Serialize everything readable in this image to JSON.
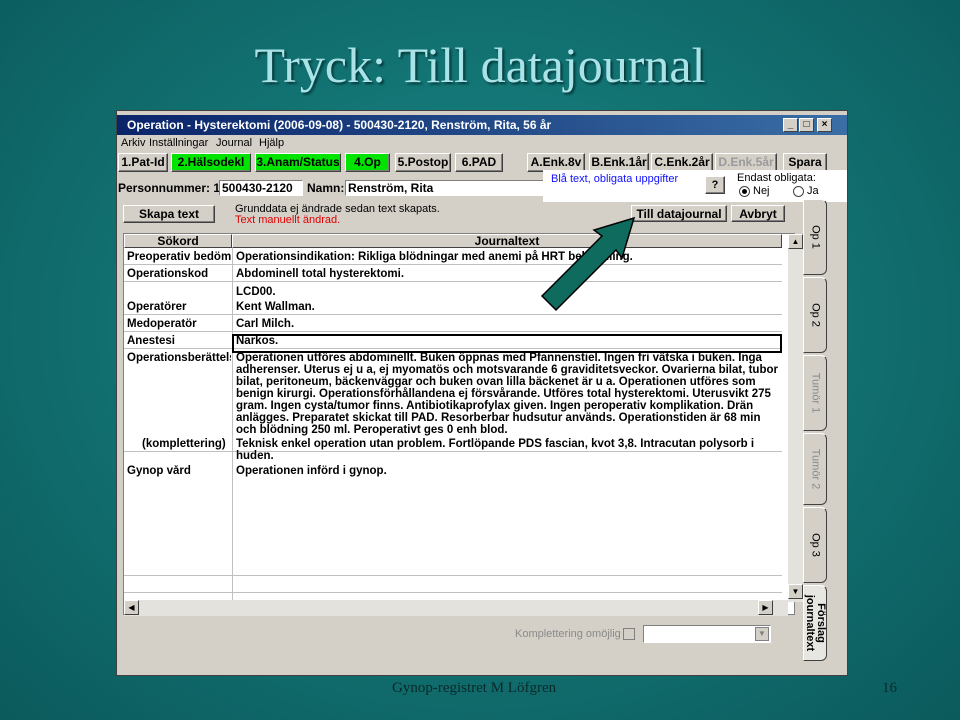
{
  "slide": {
    "title": "Tryck: Till datajournal",
    "footer": "Gynop-registret M Löfgren",
    "page_number": "16"
  },
  "window": {
    "title": "Operation - Hysterektomi (2006-09-08) - 500430-2120, Renström, Rita, 56 år",
    "controls": {
      "minimize": "_",
      "maximize": "□",
      "close": "×"
    }
  },
  "menu": [
    "Arkiv",
    "Inställningar",
    "Journal",
    "Hjälp"
  ],
  "toolbar": [
    {
      "label": "1.Pat-Id",
      "state": "normal"
    },
    {
      "label": "2.Hälsodekl",
      "state": "green"
    },
    {
      "label": "3.Anam/Status",
      "state": "green"
    },
    {
      "label": "4.Op",
      "state": "green"
    },
    {
      "label": "5.Postop",
      "state": "normal"
    },
    {
      "label": "6.PAD",
      "state": "normal"
    },
    {
      "label": "A.Enk.8v",
      "state": "normal"
    },
    {
      "label": "B.Enk.1år",
      "state": "normal"
    },
    {
      "label": "C.Enk.2år",
      "state": "normal"
    },
    {
      "label": "D.Enk.5år",
      "state": "disabled"
    },
    {
      "label": "Spara",
      "state": "normal"
    }
  ],
  "patient": {
    "pnr_label": "Personnummer: 19",
    "pnr_value": "500430-2120",
    "name_label": "Namn:",
    "name_value": "Renström, Rita"
  },
  "info": {
    "blue_note": "Blå text, obligata uppgifter",
    "help": "?",
    "only_required_label": "Endast obligata:",
    "radio_no": "Nej",
    "radio_yes": "Ja"
  },
  "actions": {
    "create_text": "Skapa text",
    "note_grey": "Grunddata ej ändrade sedan text skapats.",
    "note_red": "Text manuellt ändrad.",
    "to_journal": "Till datajournal",
    "cancel": "Avbryt"
  },
  "table": {
    "headers": [
      "Sökord",
      "Journaltext"
    ],
    "rows": [
      {
        "k": "Preoperativ bedömning",
        "v": "Operationsindikation: Rikliga blödningar med anemi på HRT behandling."
      },
      {
        "k": "Operationskod",
        "v": "Abdominell total hysterektomi."
      },
      {
        "k": "",
        "v": "LCD00."
      },
      {
        "k": "Operatörer",
        "v": "Kent Wallman."
      },
      {
        "k": "Medoperatör",
        "v": "Carl Milch."
      },
      {
        "k": "Anestesi",
        "v": "Narkos."
      },
      {
        "k": "Operationsberättelse",
        "v": "Operationen utföres abdominellt. Buken öppnas med Pfannenstiel. Ingen fri vätska i buken. Inga adherenser. Uterus ej u a, ej myomatös och motsvarande 6 graviditetsveckor. Ovarierna bilat, tubor bilat, peritoneum, bäckenväggar och buken ovan lilla bäckenet är u a. Operationen utföres som benign kirurgi. Operationsförhållandena ej försvårande. Utföres total hysterektomi. Uterusvikt 275 gram. Ingen cysta/tumor finns. Antibiotikaprofylax given. Ingen peroperativ komplikation. Drän anlägges. Preparatet skickat till PAD. Resorberbar hudsutur används. Operationstiden är 68 min och blödning 250 ml. Peroperativt ges 0 enh blod."
      },
      {
        "k": "(komplettering)",
        "v": "Teknisk enkel operation utan problem. Fortlöpande PDS fascian, kvot 3,8. Intracutan polysorb i huden."
      },
      {
        "k": "Gynop vård",
        "v": "Operationen införd i gynop."
      }
    ]
  },
  "tabs": [
    {
      "label": "Op 1",
      "state": "normal"
    },
    {
      "label": "Op 2",
      "state": "normal"
    },
    {
      "label": "Tumör 1",
      "state": "dim"
    },
    {
      "label": "Tumör 2",
      "state": "dim"
    },
    {
      "label": "Op 3",
      "state": "normal"
    },
    {
      "label": "Förslag journaltext",
      "state": "active"
    }
  ],
  "bottom": {
    "note": "Komplettering omöjlig"
  },
  "colors": {
    "titlebar": "#0a246a",
    "green_button": "#00e400",
    "arrow": "#0e6b5e",
    "required_text": "#1010ff",
    "warning_text": "#e00000"
  }
}
